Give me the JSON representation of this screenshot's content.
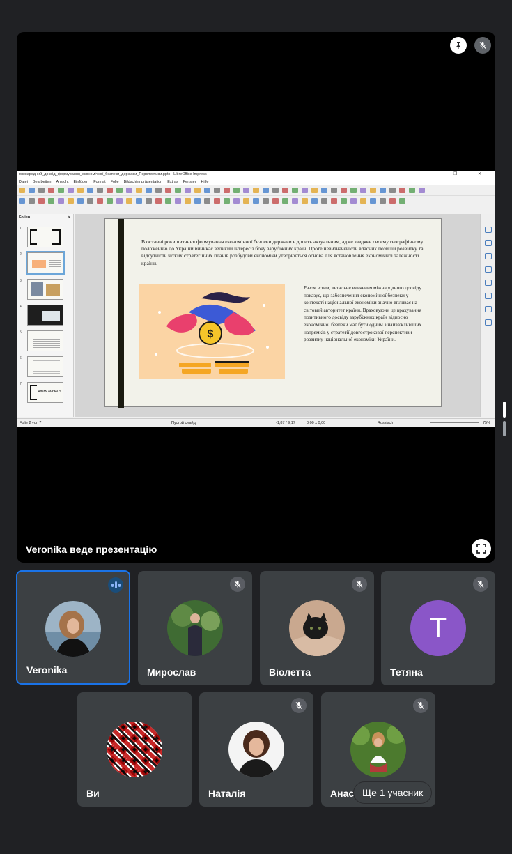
{
  "stage": {
    "presenting_label": "Veronika веде презентацію"
  },
  "libreoffice": {
    "window_title": "міжнародний_досвід_формування_економічної_безпеки_держави_Перспективи.pptx - LibreOffice Impress",
    "menu": [
      "Datei",
      "Bearbeiten",
      "Ansicht",
      "Einfügen",
      "Format",
      "Folie",
      "Bildschirmpräsentation",
      "Extras",
      "Fenster",
      "Hilfe"
    ],
    "panel_title": "Folien",
    "thumb_numbers": [
      "1",
      "2",
      "3",
      "4",
      "5",
      "6",
      "7"
    ],
    "slide": {
      "paragraph1": "В останні роки питання формування економічної безпеки держави є досить актуальним, адже завдяки своєму географічному положенню до України виникає великий інтерес з боку зарубіжних країн. Проте невизначеність власних позицій розвитку та відсутність чітких стратегічних планів розбудови економіки утворюється основа для встановлення економічної залежності країни.",
      "paragraph2": "Разом з тим, детальне вивчення міжнародного досвіду показує, що забезпечення економічної безпеки у контексті національної економіки значно впливає на світовий авторитет країни. Враховуючи це врахування позитивного досвіду зарубіжних країн відносно економічної безпеки має бути одним з найважливіших напрямків у стратегії довгострокової перспективи розвитку національної економіки України."
    },
    "thumb7_text": "ДЯКУЮ ЗА УВАГУ!",
    "status": {
      "slide_pos": "Folie 2 von 7",
      "layout": "Пустой слайд",
      "coords": "-1,87 / 9,17",
      "size": "0,00 x 0,00",
      "language": "Russisch",
      "zoom": "75%"
    }
  },
  "participants": [
    {
      "name": "Veronika",
      "speaking": true
    },
    {
      "name": "Мирослав",
      "muted": true
    },
    {
      "name": "Віолетта",
      "muted": true
    },
    {
      "name": "Тетяна",
      "muted": true,
      "initial": "T",
      "avatar_color": "#8a56c8"
    },
    {
      "name": "Ви"
    },
    {
      "name": "Наталія",
      "muted": true
    },
    {
      "name": "Анаст",
      "muted": true
    }
  ],
  "more_participants": "Ще 1 учасник"
}
